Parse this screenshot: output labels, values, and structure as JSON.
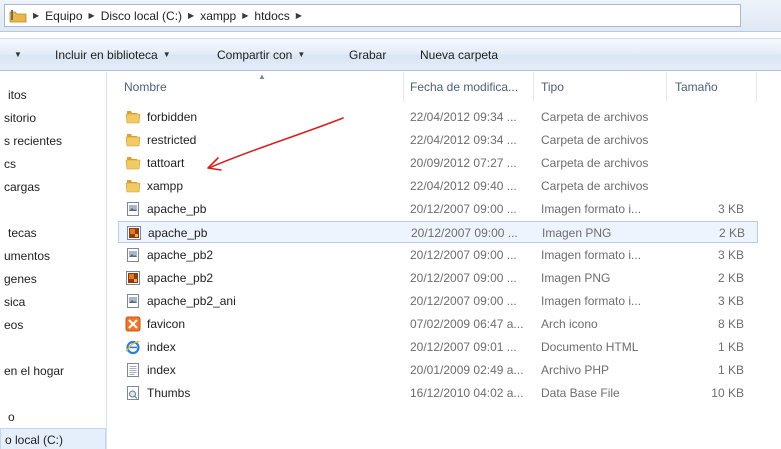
{
  "address": {
    "crumbs": [
      "Equipo",
      "Disco local (C:)",
      "xampp",
      "htdocs"
    ]
  },
  "toolbar": {
    "organize_label": "",
    "include_label": "Incluir en biblioteca",
    "share_label": "Compartir con",
    "burn_label": "Grabar",
    "new_folder_label": "Nueva carpeta"
  },
  "nav": {
    "items": [
      "itos",
      "sitorio",
      "s recientes",
      "cs",
      "cargas",
      "tecas",
      "umentos",
      "genes",
      "sica",
      "eos",
      "en el hogar",
      "o",
      "o local (C:)"
    ]
  },
  "columns": {
    "name": "Nombre",
    "date": "Fecha de modifica...",
    "type": "Tipo",
    "size": "Tamaño"
  },
  "files": [
    {
      "name": "forbidden",
      "date": "22/04/2012 09:34 ...",
      "type": "Carpeta de archivos",
      "size": "",
      "icon": "folder-icon"
    },
    {
      "name": "restricted",
      "date": "22/04/2012 09:34 ...",
      "type": "Carpeta de archivos",
      "size": "",
      "icon": "folder-icon"
    },
    {
      "name": "tattoart",
      "date": "20/09/2012 07:27 ...",
      "type": "Carpeta de archivos",
      "size": "",
      "icon": "folder-icon"
    },
    {
      "name": "xampp",
      "date": "22/04/2012 09:40 ...",
      "type": "Carpeta de archivos",
      "size": "",
      "icon": "folder-icon"
    },
    {
      "name": "apache_pb",
      "date": "20/12/2007 09:00 ...",
      "type": "Imagen formato i...",
      "size": "3 KB",
      "icon": "image-file-icon"
    },
    {
      "name": "apache_pb",
      "date": "20/12/2007 09:00 ...",
      "type": "Imagen PNG",
      "size": "2 KB",
      "icon": "png-image-icon"
    },
    {
      "name": "apache_pb2",
      "date": "20/12/2007 09:00 ...",
      "type": "Imagen formato i...",
      "size": "3 KB",
      "icon": "image-file-icon"
    },
    {
      "name": "apache_pb2",
      "date": "20/12/2007 09:00 ...",
      "type": "Imagen PNG",
      "size": "2 KB",
      "icon": "png-image-icon"
    },
    {
      "name": "apache_pb2_ani",
      "date": "20/12/2007 09:00 ...",
      "type": "Imagen formato i...",
      "size": "3 KB",
      "icon": "image-file-icon"
    },
    {
      "name": "favicon",
      "date": "07/02/2009 06:47 a...",
      "type": "Arch icono",
      "size": "8 KB",
      "icon": "xampp-favicon-icon"
    },
    {
      "name": "index",
      "date": "20/12/2007 09:01 ...",
      "type": "Documento HTML",
      "size": "1 KB",
      "icon": "internet-explorer-icon"
    },
    {
      "name": "index",
      "date": "20/01/2009 02:49 a...",
      "type": "Archivo PHP",
      "size": "1 KB",
      "icon": "text-file-icon"
    },
    {
      "name": "Thumbs",
      "date": "16/12/2010 04:02 a...",
      "type": "Data Base File",
      "size": "10 KB",
      "icon": "database-file-icon"
    }
  ],
  "colors": {
    "folder": "#e8b74a",
    "selection": "#eef4fd",
    "annotation": "#d62020",
    "header_text": "#4c607a"
  }
}
